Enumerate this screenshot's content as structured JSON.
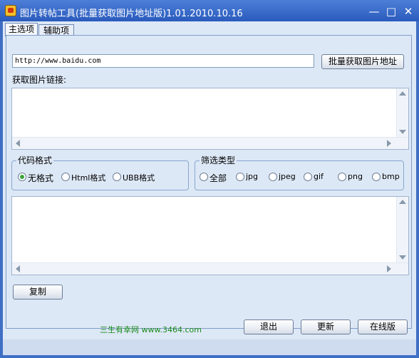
{
  "window": {
    "title": "图片转帖工具(批量获取图片地址版)1.01.2010.10.16",
    "minimize_glyph": "—",
    "maximize_glyph": "□",
    "close_glyph": "✕"
  },
  "tabs": [
    {
      "label": "主选项",
      "active": true
    },
    {
      "label": "辅助项",
      "active": false
    }
  ],
  "main": {
    "url_value": "http://www.baidu.com",
    "batch_button_label": "批量获取图片地址",
    "links_label": "获取图片链接:",
    "links_text": "",
    "output_text": "",
    "copy_button_label": "复制"
  },
  "code_format": {
    "title": "代码格式",
    "options": [
      {
        "label": "无格式",
        "checked": true
      },
      {
        "label": "Html格式",
        "checked": false
      },
      {
        "label": "UBB格式",
        "checked": false
      }
    ]
  },
  "filter_type": {
    "title": "筛选类型",
    "options": [
      {
        "label": "全部",
        "checked": false
      },
      {
        "label": "jpg",
        "checked": false
      },
      {
        "label": "jpeg",
        "checked": false
      },
      {
        "label": "gif",
        "checked": false
      },
      {
        "label": "png",
        "checked": false
      },
      {
        "label": "bmp",
        "checked": false
      }
    ]
  },
  "footer": {
    "site_text": "三生有幸网 www.3464.com",
    "exit_label": "退出",
    "update_label": "更新",
    "online_label": "在线版"
  },
  "icons": {
    "scroll_up": "scroll-up-arrow-icon",
    "scroll_down": "scroll-down-arrow-icon",
    "scroll_left": "scroll-left-arrow-icon",
    "scroll_right": "scroll-right-arrow-icon",
    "app": "app-icon"
  },
  "colors": {
    "titlebar": "#2a5bbd",
    "client_bg": "#dde8f6",
    "radio_check": "#3aa63a",
    "footer_link": "#1a8a1a"
  }
}
